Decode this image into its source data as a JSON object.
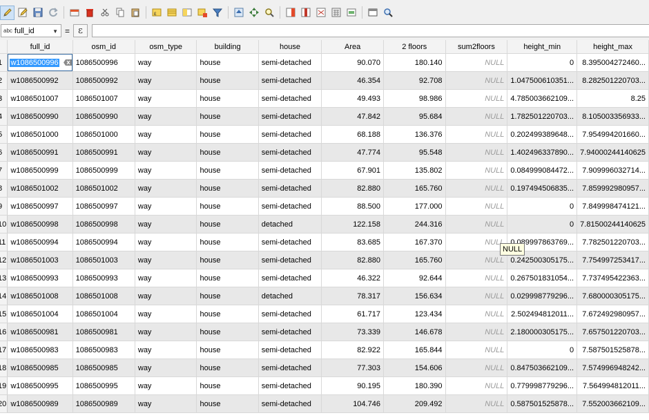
{
  "toolbar": {
    "buttons": [
      {
        "name": "toggle-editing-button",
        "icon": "pencil-icon",
        "active": true
      },
      {
        "name": "toggle-multi-edit-button",
        "icon": "multi-edit-pencil-icon",
        "active": false
      },
      {
        "name": "save-edits-button",
        "icon": "save-icon",
        "active": false
      },
      {
        "name": "reload-table-button",
        "icon": "refresh-icon",
        "active": false
      },
      {
        "name": "add-feature-button",
        "icon": "add-feature-icon",
        "active": false
      },
      {
        "name": "delete-selected-button",
        "icon": "trash-icon",
        "active": false
      },
      {
        "name": "cut-button",
        "icon": "scissors-icon",
        "active": false
      },
      {
        "name": "copy-button",
        "icon": "copy-icon",
        "active": false
      },
      {
        "name": "paste-button",
        "icon": "paste-icon",
        "active": false
      },
      {
        "name": "select-by-expression-button",
        "icon": "expression-select-icon",
        "active": false
      },
      {
        "name": "select-all-button",
        "icon": "select-all-icon",
        "active": false
      },
      {
        "name": "invert-selection-button",
        "icon": "invert-selection-icon",
        "active": false
      },
      {
        "name": "deselect-all-button",
        "icon": "deselect-icon",
        "active": false
      },
      {
        "name": "filter-button",
        "icon": "filter-icon",
        "active": false
      },
      {
        "name": "move-selection-to-top-button",
        "icon": "move-top-icon",
        "active": false
      },
      {
        "name": "pan-to-selected-button",
        "icon": "pan-icon",
        "active": false
      },
      {
        "name": "zoom-to-selected-button",
        "icon": "zoom-selected-icon",
        "active": false
      },
      {
        "name": "new-field-button",
        "icon": "new-field-icon",
        "active": false
      },
      {
        "name": "delete-field-button",
        "icon": "delete-field-icon",
        "active": false
      },
      {
        "name": "organize-columns-button",
        "icon": "organize-columns-icon",
        "active": false
      },
      {
        "name": "field-calculator-button",
        "icon": "calculator-icon",
        "active": false
      },
      {
        "name": "conditional-formatting-button",
        "icon": "conditional-format-icon",
        "active": false
      },
      {
        "name": "dock-table-button",
        "icon": "dock-icon",
        "active": false
      },
      {
        "name": "actions-button",
        "icon": "actions-icon",
        "active": false
      }
    ]
  },
  "expression_bar": {
    "field_type": "abc",
    "field_name": "full_id",
    "equals": "=",
    "expr_button": "ε",
    "value": ""
  },
  "table": {
    "columns": [
      "full_id",
      "osm_id",
      "osm_type",
      "building",
      "house",
      "Area",
      "2 floors",
      "sum2floors",
      "height_min",
      "height_max"
    ],
    "rows": [
      {
        "n": "1",
        "full_id": "w1086500996",
        "osm_id": "1086500996",
        "osm_type": "way",
        "building": "house",
        "house": "semi-detached",
        "area": "90.070",
        "floors2": "180.140",
        "sum2floors": "NULL",
        "height_min": "0",
        "height_max": "8.395004272460..."
      },
      {
        "n": "2",
        "full_id": "w1086500992",
        "osm_id": "1086500992",
        "osm_type": "way",
        "building": "house",
        "house": "semi-detached",
        "area": "46.354",
        "floors2": "92.708",
        "sum2floors": "NULL",
        "height_min": "1.047500610351...",
        "height_max": "8.282501220703..."
      },
      {
        "n": "3",
        "full_id": "w1086501007",
        "osm_id": "1086501007",
        "osm_type": "way",
        "building": "house",
        "house": "semi-detached",
        "area": "49.493",
        "floors2": "98.986",
        "sum2floors": "NULL",
        "height_min": "4.785003662109...",
        "height_max": "8.25"
      },
      {
        "n": "4",
        "full_id": "w1086500990",
        "osm_id": "1086500990",
        "osm_type": "way",
        "building": "house",
        "house": "semi-detached",
        "area": "47.842",
        "floors2": "95.684",
        "sum2floors": "NULL",
        "height_min": "1.782501220703...",
        "height_max": "8.105003356933..."
      },
      {
        "n": "5",
        "full_id": "w1086501000",
        "osm_id": "1086501000",
        "osm_type": "way",
        "building": "house",
        "house": "semi-detached",
        "area": "68.188",
        "floors2": "136.376",
        "sum2floors": "NULL",
        "height_min": "0.202499389648...",
        "height_max": "7.954994201660..."
      },
      {
        "n": "6",
        "full_id": "w1086500991",
        "osm_id": "1086500991",
        "osm_type": "way",
        "building": "house",
        "house": "semi-detached",
        "area": "47.774",
        "floors2": "95.548",
        "sum2floors": "NULL",
        "height_min": "1.402496337890...",
        "height_max": "7.94000244140625"
      },
      {
        "n": "7",
        "full_id": "w1086500999",
        "osm_id": "1086500999",
        "osm_type": "way",
        "building": "house",
        "house": "semi-detached",
        "area": "67.901",
        "floors2": "135.802",
        "sum2floors": "NULL",
        "height_min": "0.084999084472...",
        "height_max": "7.909996032714..."
      },
      {
        "n": "8",
        "full_id": "w1086501002",
        "osm_id": "1086501002",
        "osm_type": "way",
        "building": "house",
        "house": "semi-detached",
        "area": "82.880",
        "floors2": "165.760",
        "sum2floors": "NULL",
        "height_min": "0.197494506835...",
        "height_max": "7.859992980957..."
      },
      {
        "n": "9",
        "full_id": "w1086500997",
        "osm_id": "1086500997",
        "osm_type": "way",
        "building": "house",
        "house": "semi-detached",
        "area": "88.500",
        "floors2": "177.000",
        "sum2floors": "NULL",
        "height_min": "0",
        "height_max": "7.849998474121..."
      },
      {
        "n": "10",
        "full_id": "w1086500998",
        "osm_id": "1086500998",
        "osm_type": "way",
        "building": "house",
        "house": "detached",
        "area": "122.158",
        "floors2": "244.316",
        "sum2floors": "NULL",
        "height_min": "0",
        "height_max": "7.81500244140625"
      },
      {
        "n": "11",
        "full_id": "w1086500994",
        "osm_id": "1086500994",
        "osm_type": "way",
        "building": "house",
        "house": "semi-detached",
        "area": "83.685",
        "floors2": "167.370",
        "sum2floors": "NULL",
        "height_min": "0.089997863769...",
        "height_max": "7.782501220703..."
      },
      {
        "n": "12",
        "full_id": "w1086501003",
        "osm_id": "1086501003",
        "osm_type": "way",
        "building": "house",
        "house": "semi-detached",
        "area": "82.880",
        "floors2": "165.760",
        "sum2floors": "NULL",
        "height_min": "0.242500305175...",
        "height_max": "7.754997253417..."
      },
      {
        "n": "13",
        "full_id": "w1086500993",
        "osm_id": "1086500993",
        "osm_type": "way",
        "building": "house",
        "house": "semi-detached",
        "area": "46.322",
        "floors2": "92.644",
        "sum2floors": "NULL",
        "height_min": "0.267501831054...",
        "height_max": "7.737495422363..."
      },
      {
        "n": "14",
        "full_id": "w1086501008",
        "osm_id": "1086501008",
        "osm_type": "way",
        "building": "house",
        "house": "detached",
        "area": "78.317",
        "floors2": "156.634",
        "sum2floors": "NULL",
        "height_min": "0.029998779296...",
        "height_max": "7.680000305175..."
      },
      {
        "n": "15",
        "full_id": "w1086501004",
        "osm_id": "1086501004",
        "osm_type": "way",
        "building": "house",
        "house": "semi-detached",
        "area": "61.717",
        "floors2": "123.434",
        "sum2floors": "NULL",
        "height_min": "2.502494812011...",
        "height_max": "7.672492980957..."
      },
      {
        "n": "16",
        "full_id": "w1086500981",
        "osm_id": "1086500981",
        "osm_type": "way",
        "building": "house",
        "house": "semi-detached",
        "area": "73.339",
        "floors2": "146.678",
        "sum2floors": "NULL",
        "height_min": "2.180000305175...",
        "height_max": "7.657501220703..."
      },
      {
        "n": "17",
        "full_id": "w1086500983",
        "osm_id": "1086500983",
        "osm_type": "way",
        "building": "house",
        "house": "semi-detached",
        "area": "82.922",
        "floors2": "165.844",
        "sum2floors": "NULL",
        "height_min": "0",
        "height_max": "7.587501525878..."
      },
      {
        "n": "18",
        "full_id": "w1086500985",
        "osm_id": "1086500985",
        "osm_type": "way",
        "building": "house",
        "house": "semi-detached",
        "area": "77.303",
        "floors2": "154.606",
        "sum2floors": "NULL",
        "height_min": "0.847503662109...",
        "height_max": "7.574996948242..."
      },
      {
        "n": "19",
        "full_id": "w1086500995",
        "osm_id": "1086500995",
        "osm_type": "way",
        "building": "house",
        "house": "semi-detached",
        "area": "90.195",
        "floors2": "180.390",
        "sum2floors": "NULL",
        "height_min": "0.779998779296...",
        "height_max": "7.564994812011..."
      },
      {
        "n": "20",
        "full_id": "w1086500989",
        "osm_id": "1086500989",
        "osm_type": "way",
        "building": "house",
        "house": "semi-detached",
        "area": "104.746",
        "floors2": "209.492",
        "sum2floors": "NULL",
        "height_min": "0.587501525878...",
        "height_max": "7.552003662109..."
      }
    ]
  },
  "tooltip": {
    "text": "NULL"
  },
  "colors": {
    "selection": "#3399ff",
    "alt_row": "#e8e8e8",
    "null_text": "#9a9a9a"
  }
}
